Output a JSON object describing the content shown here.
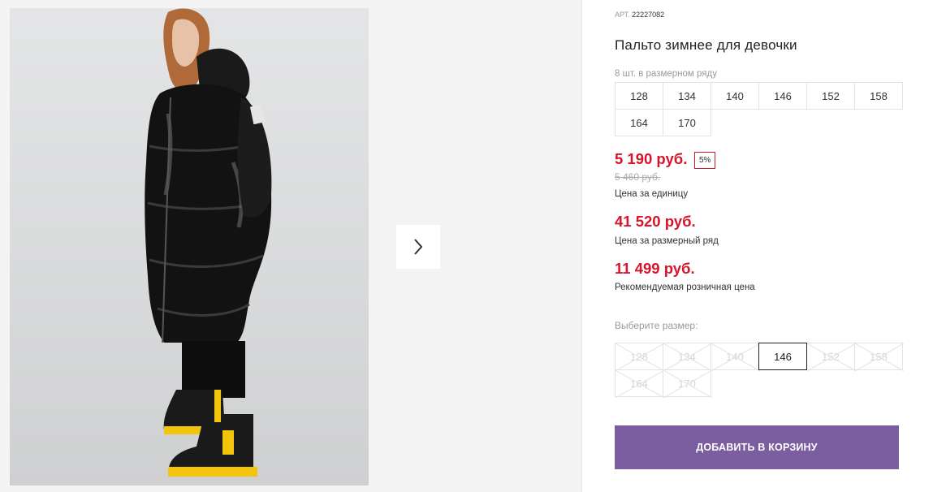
{
  "product": {
    "art_label": "АРТ.",
    "art_number": "22227082",
    "title": "Пальто зимнее для девочки",
    "pack_note": "8 шт. в размерном ряду",
    "pack_sizes": [
      "128",
      "134",
      "140",
      "146",
      "152",
      "158",
      "164",
      "170"
    ],
    "price": "5 190 руб.",
    "discount_badge": "5%",
    "old_price": "5 460 руб.",
    "unit_price_label": "Цена за единицу",
    "pack_price": "41 520 руб.",
    "pack_price_label": "Цена за размерный ряд",
    "retail_price": "11 499 руб.",
    "retail_price_label": "Рекомендуемая розничная цена",
    "choose_size_label": "Выберите размер:",
    "size_options": [
      {
        "label": "128",
        "state": "disabled"
      },
      {
        "label": "134",
        "state": "disabled"
      },
      {
        "label": "140",
        "state": "disabled"
      },
      {
        "label": "146",
        "state": "selected"
      },
      {
        "label": "152",
        "state": "disabled"
      },
      {
        "label": "158",
        "state": "disabled"
      },
      {
        "label": "164",
        "state": "disabled"
      },
      {
        "label": "170",
        "state": "disabled"
      }
    ],
    "add_to_cart": "ДОБАВИТЬ В КОРЗИНУ"
  },
  "gallery": {
    "next_icon": "chevron-right-icon",
    "image_subject": "girl-in-black-winter-coat"
  },
  "colors": {
    "price_red": "#d6142b",
    "button_purple": "#7b5ea0",
    "gallery_bg": "#f4f4f4"
  }
}
